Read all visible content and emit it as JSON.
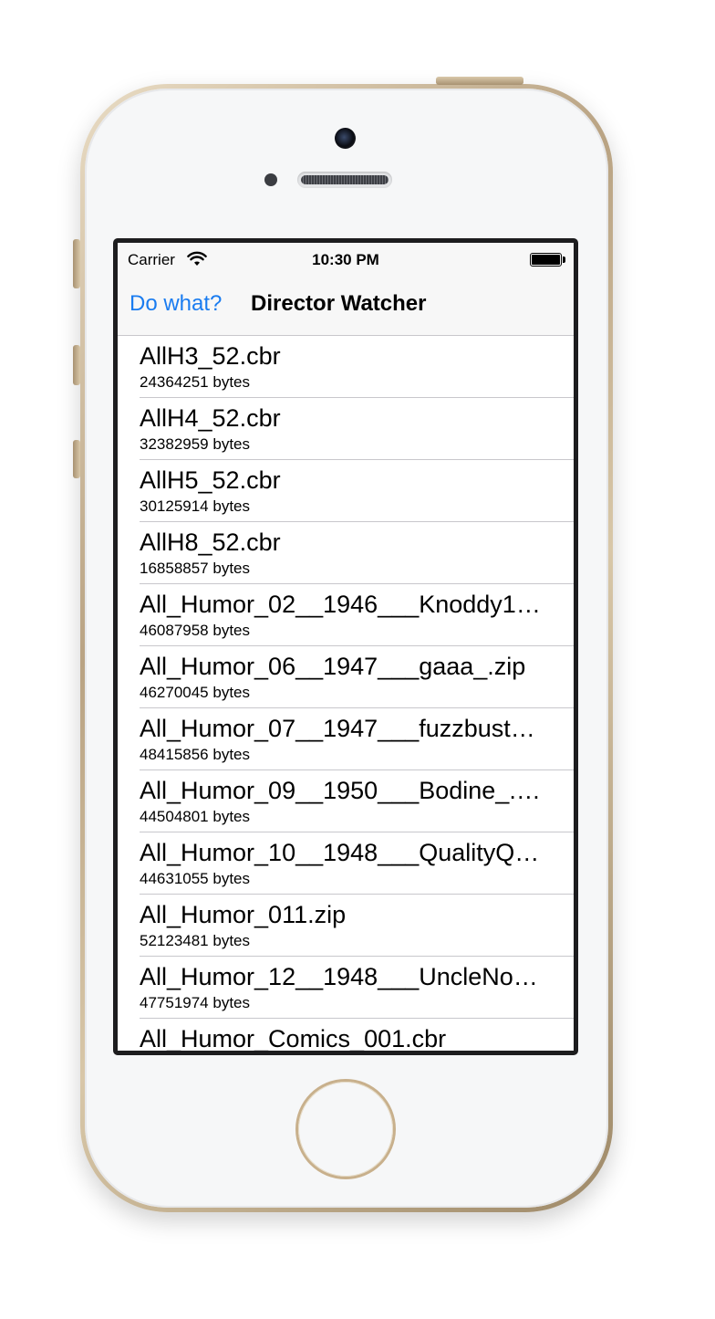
{
  "status_bar": {
    "carrier": "Carrier",
    "time": "10:30 PM"
  },
  "nav": {
    "back_label": "Do what?",
    "title": "Director Watcher"
  },
  "files": [
    {
      "name": "AllH3_52.cbr",
      "size": "24364251 bytes"
    },
    {
      "name": "AllH4_52.cbr",
      "size": "32382959 bytes"
    },
    {
      "name": "AllH5_52.cbr",
      "size": "30125914 bytes"
    },
    {
      "name": "AllH8_52.cbr",
      "size": "16858857 bytes"
    },
    {
      "name": "All_Humor_02__1946___Knoddy1…",
      "size": "46087958 bytes"
    },
    {
      "name": "All_Humor_06__1947___gaaa_.zip",
      "size": "46270045 bytes"
    },
    {
      "name": "All_Humor_07__1947___fuzzbust…",
      "size": "48415856 bytes"
    },
    {
      "name": "All_Humor_09__1950___Bodine_.…",
      "size": "44504801 bytes"
    },
    {
      "name": "All_Humor_10__1948___QualityQ…",
      "size": "44631055 bytes"
    },
    {
      "name": "All_Humor_011.zip",
      "size": "52123481 bytes"
    },
    {
      "name": "All_Humor_12__1948___UncleNo…",
      "size": "47751974 bytes"
    },
    {
      "name": "All_Humor_Comics_001.cbr",
      "size": ""
    }
  ],
  "colors": {
    "accent": "#1a7cf0",
    "separator": "#c8c7cc",
    "navbar": "#f7f7f7"
  }
}
